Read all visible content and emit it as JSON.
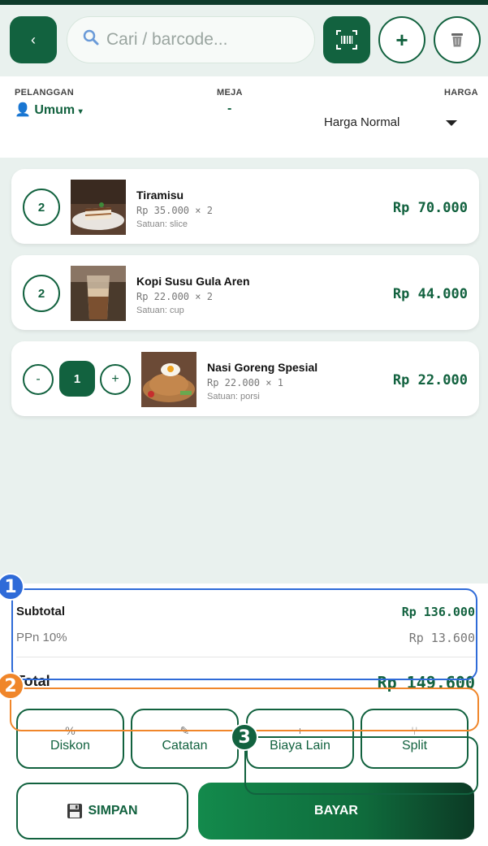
{
  "header": {
    "back_label": "‹",
    "search_placeholder": "Cari / barcode...",
    "add_label": "+"
  },
  "info": {
    "customer_label": "PELANGGAN",
    "customer_value": "Umum",
    "table_label": "MEJA",
    "table_value": "-",
    "price_label": "HARGA",
    "price_value": "Harga Normal"
  },
  "cart": [
    {
      "qty": "2",
      "name": "Tiramisu",
      "unit_price": "Rp 35.000 × 2",
      "unit": "Satuan: slice",
      "total": "Rp 70.000"
    },
    {
      "qty": "2",
      "name": "Kopi Susu Gula Aren",
      "unit_price": "Rp 22.000 × 2",
      "unit": "Satuan: cup",
      "total": "Rp 44.000"
    },
    {
      "qty": "1",
      "name": "Nasi Goreng Spesial",
      "unit_price": "Rp 22.000 × 1",
      "unit": "Satuan: porsi",
      "total": "Rp 22.000",
      "minus": "-",
      "plus": "+"
    }
  ],
  "summary": {
    "subtotal_label": "Subtotal",
    "subtotal_value": "Rp 136.000",
    "tax_label": "PPn 10%",
    "tax_value": "Rp 13.600",
    "total_label": "Total",
    "total_value": "Rp 149.600"
  },
  "actions": {
    "discount_icon": "%",
    "discount": "Diskon",
    "note_icon": "✎",
    "note": "Catatan",
    "fee_icon": "+",
    "fee": "Biaya Lain",
    "split_icon": "⑂",
    "split": "Split",
    "save": "SIMPAN",
    "pay": "BAYAR"
  },
  "annotations": [
    "1",
    "2",
    "3"
  ],
  "colors": {
    "primary": "#12623f",
    "anno1": "#2f6bd8",
    "anno2": "#f0862a",
    "anno3": "#12623f"
  }
}
